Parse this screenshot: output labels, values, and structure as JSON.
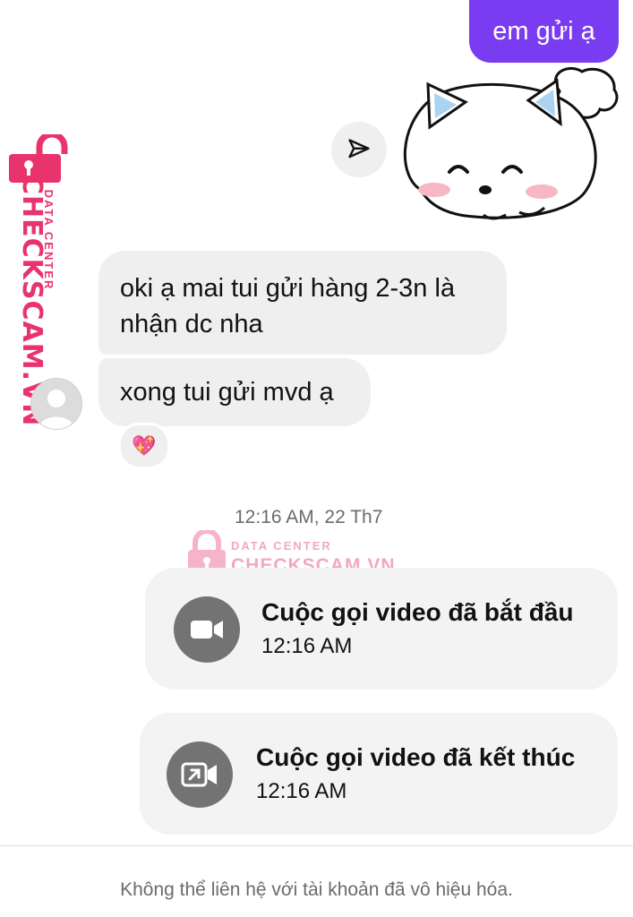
{
  "thread": {
    "outgoing_message": "em gửi ạ",
    "incoming_messages": [
      "oki ạ mai tui gửi hàng 2-3n là nhận dc nha",
      "xong tui gửi mvd ạ"
    ],
    "incoming_line1": "oki ạ mai tui gửi hàng 2-3n là",
    "incoming_line2": "nhận dc nha",
    "reaction": "💖",
    "timestamp": "12:16 AM, 22 Th7"
  },
  "calls": [
    {
      "title": "Cuộc gọi video đã bắt đầu",
      "time": "12:16 AM",
      "icon": "video-camera-icon"
    },
    {
      "title": "Cuộc gọi video đã kết thúc",
      "time": "12:16 AM",
      "icon": "video-call-end-icon"
    }
  ],
  "watermark": {
    "small": "DATA CENTER",
    "big": "CHECKSCAM.VN",
    "color": "#e8336d"
  },
  "footer": {
    "notice": "Không thể liên hệ với tài khoản đã vô hiệu hóa."
  },
  "colors": {
    "outgoing_bubble": "#7a3cf0",
    "incoming_bubble": "#efefef",
    "call_icon_bg": "#737373"
  }
}
